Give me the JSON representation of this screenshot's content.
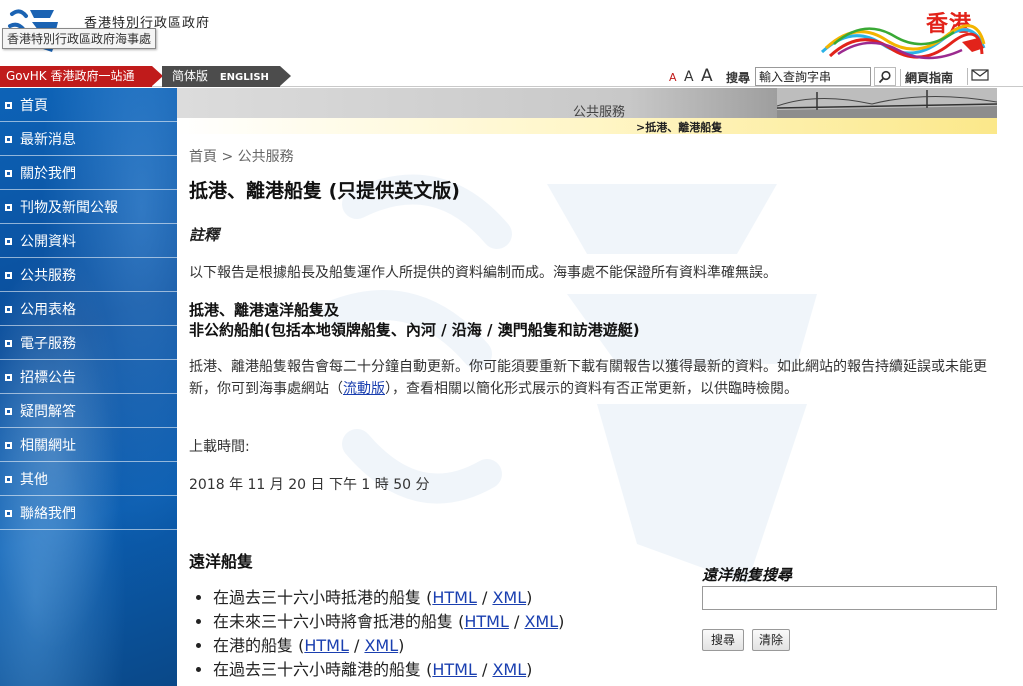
{
  "header": {
    "department_name": "香港特別行政區政府",
    "logo_tooltip": "香港特別行政區政府海事處",
    "brand_text": "香港"
  },
  "govbar": {
    "govhk_label": "GovHK 香港政府一站通",
    "lang_simplified": "简体版",
    "lang_english": "ENGLISH",
    "font_small": "A",
    "font_medium": "A",
    "font_large": "A",
    "search_label": "搜尋",
    "search_placeholder": "輸入查詢字串",
    "sitemap_label": "網頁指南"
  },
  "sidebar": {
    "items": [
      {
        "label": "首頁"
      },
      {
        "label": "最新消息"
      },
      {
        "label": "關於我們"
      },
      {
        "label": "刊物及新聞公報"
      },
      {
        "label": "公開資料"
      },
      {
        "label": "公共服務"
      },
      {
        "label": "公用表格"
      },
      {
        "label": "電子服務"
      },
      {
        "label": "招標公告"
      },
      {
        "label": "疑問解答"
      },
      {
        "label": "相關網址"
      },
      {
        "label": "其他"
      },
      {
        "label": "聯絡我們"
      }
    ]
  },
  "banner": {
    "title": "公共服務",
    "sub": ">抵港、離港船隻"
  },
  "main": {
    "breadcrumb_home": "首頁",
    "breadcrumb_sep": " > ",
    "breadcrumb_current": "公共服務",
    "title": "抵港、離港船隻 (只提供英文版)",
    "remark_heading": "註釋",
    "remark_text": "以下報告是根據船長及船隻運作人所提供的資料編制而成。海事處不能保證所有資料準確無誤。",
    "vessel_heading_line1": "抵港、離港遠洋船隻及",
    "vessel_heading_line2": "非公約船舶(包括本地領牌船隻、內河 / 沿海 / 澳門船隻和訪港遊艇)",
    "update_text_before": "抵港、離港船隻報告會每二十分鐘自動更新。你可能須要重新下載有關報告以獲得最新的資料。如此網站的報告持續延誤或未能更新，你可到海事處網站（",
    "update_link": "流動版",
    "update_text_after": "），查看相關以簡化形式展示的資料有否正常更新，以供臨時檢閱。",
    "upload_label": "上載時間:",
    "upload_time": "2018 年 11 月 20 日 下午 1 時 50 分"
  },
  "ocean": {
    "heading": "遠洋船隻",
    "html_label": "HTML",
    "xml_label": "XML",
    "items": [
      {
        "label": "在過去三十六小時抵港的船隻"
      },
      {
        "label": "在未來三十六小時將會抵港的船隻"
      },
      {
        "label": "在港的船隻"
      },
      {
        "label": "在過去三十六小時離港的船隻"
      }
    ]
  },
  "search_panel": {
    "title": "遠洋船隻搜尋",
    "search_button": "搜尋",
    "clear_button": "清除"
  },
  "colors": {
    "govhk_red": "#c01b1b",
    "sidebar_blue": "#0a4c99",
    "link_blue": "#1a3fb0",
    "brand_red": "#e2231a"
  }
}
